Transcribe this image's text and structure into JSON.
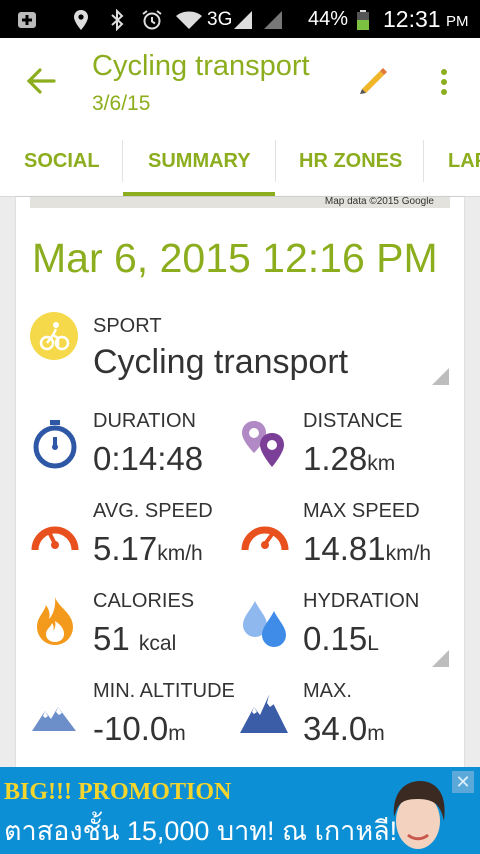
{
  "status_bar": {
    "network": "3G",
    "battery": "44%",
    "time": "12:31",
    "ampm": "PM"
  },
  "app_bar": {
    "title": "Cycling transport",
    "subtitle": "3/6/15"
  },
  "tabs": [
    {
      "label": "SOCIAL"
    },
    {
      "label": "SUMMARY",
      "selected": true
    },
    {
      "label": "HR ZONES"
    },
    {
      "label": "LAPS"
    }
  ],
  "map": {
    "credit": "Map data ©2015 Google"
  },
  "workout": {
    "date": "Mar 6, 2015 12:16 PM"
  },
  "sport": {
    "label": "SPORT",
    "value": "Cycling transport"
  },
  "stats": {
    "duration": {
      "label": "DURATION",
      "value": "0:14:48"
    },
    "distance": {
      "label": "DISTANCE",
      "value": "1.28",
      "unit": "km"
    },
    "avg_speed": {
      "label": "AVG. SPEED",
      "value": "5.17",
      "unit": "km/h"
    },
    "max_speed": {
      "label": "MAX SPEED",
      "value": "14.81",
      "unit": "km/h"
    },
    "calories": {
      "label": "CALORIES",
      "value": "51",
      "unit": "kcal"
    },
    "hydration": {
      "label": "HYDRATION",
      "value": "0.15",
      "unit": "L"
    },
    "min_altitude": {
      "label": "MIN. ALTITUDE",
      "value": "-10.0",
      "unit": "m"
    },
    "max_altitude": {
      "label": "MAX.",
      "value": "34.0",
      "unit": "m"
    }
  },
  "ad": {
    "line1": "BIG!!! PROMOTION",
    "line2": "ตาสองชั้น 15,000 บาท! ณ เกาหลี!"
  },
  "colors": {
    "accent": "#8cae1e",
    "sport_icon": "#f5d94a",
    "duration_icon": "#2e57a6",
    "speed_icon": "#e8501e",
    "calories_icon": "#f39a1d",
    "hydration_icon": "#3f8be8",
    "distance_icon": "#7b3f97",
    "altitude_icon": "#3b5da8"
  }
}
